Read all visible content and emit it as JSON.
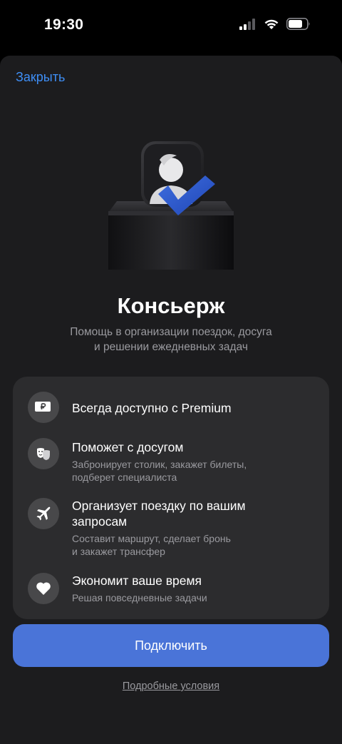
{
  "status_bar": {
    "time": "19:30"
  },
  "sheet": {
    "close_label": "Закрыть",
    "title": "Консьерж",
    "subtitle_line1": "Помощь в организации поездок, досуга",
    "subtitle_line2": "и решении ежедневных задач",
    "features": [
      {
        "icon": "ruble-card-icon",
        "title": "Всегда доступно с Premium"
      },
      {
        "icon": "theater-masks-icon",
        "title": "Поможет с досугом",
        "desc_line1": "Забронирует столик, закажет билеты,",
        "desc_line2": "подберет специалиста"
      },
      {
        "icon": "airplane-icon",
        "title_line1": "Организует поездку по вашим",
        "title_line2": "запросам",
        "desc_line1": "Составит маршрут, сделает бронь",
        "desc_line2": "и закажет трансфер"
      },
      {
        "icon": "heart-icon",
        "title": "Экономит ваше время",
        "desc_line1": "Решая повседневные задачи"
      }
    ],
    "connect_label": "Подключить",
    "terms_label": "Подробные условия"
  },
  "colors": {
    "accent": "#4a74d8",
    "link": "#3e8ef5",
    "sheet_background": "#1c1c1e",
    "card_background": "#2c2c2e",
    "secondary_text": "#9a9a9f"
  }
}
